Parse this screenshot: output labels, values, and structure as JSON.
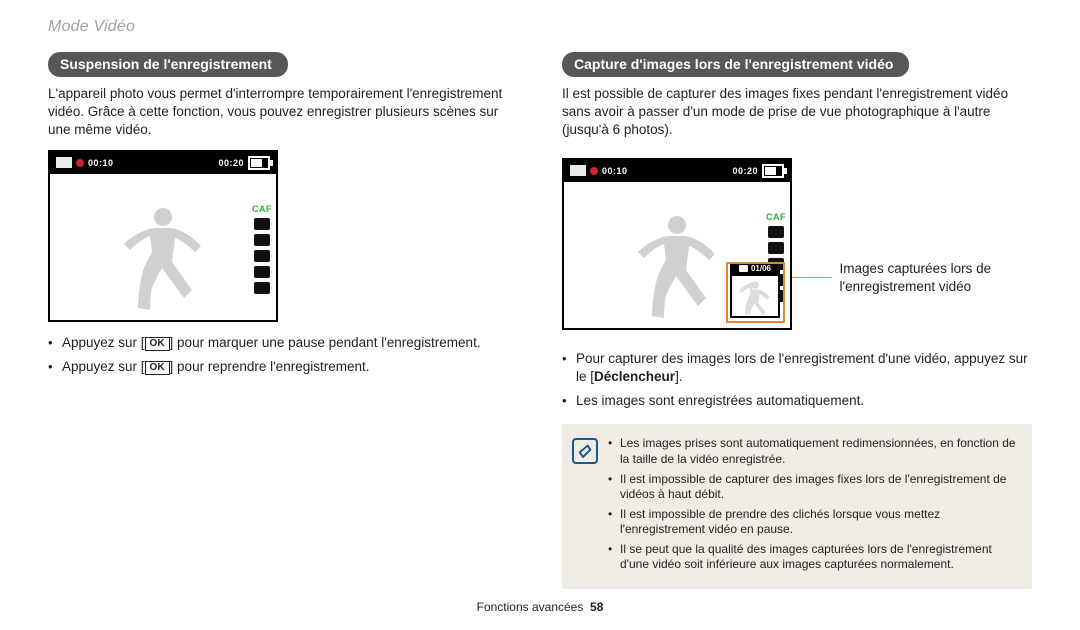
{
  "header": {
    "section": "Mode Vidéo"
  },
  "left": {
    "heading": "Suspension de l'enregistrement",
    "intro": "L'appareil photo vous permet d'interrompre temporairement l'enregistrement vidéo. Grâce à cette fonction, vous pouvez enregistrer plusieurs scènes sur une même vidéo.",
    "cam": {
      "elapsed": "00:10",
      "remaining": "00:20",
      "caf": "CAF"
    },
    "bul1a": "Appuyez sur [",
    "bul1b": "] pour marquer une pause pendant l'enregistrement.",
    "bul2a": "Appuyez sur [",
    "bul2b": "] pour reprendre l'enregistrement.",
    "ok": "OK"
  },
  "right": {
    "heading": "Capture d'images lors de l'enregistrement vidéo",
    "intro": "Il est possible de capturer des images fixes pendant l'enregistrement vidéo sans avoir à passer d'un mode de prise de vue photographique à l'autre (jusqu'à 6 photos).",
    "cam": {
      "elapsed": "00:10",
      "remaining": "00:20",
      "caf": "CAF",
      "capture_counter": "01/06"
    },
    "callout": "Images capturées lors de l'enregistrement vidéo",
    "bul1a": "Pour capturer des images lors de l'enregistrement d'une vidéo, appuyez sur le [",
    "bul1b": "Déclencheur",
    "bul1c": "].",
    "bul2": "Les images sont enregistrées automatiquement.",
    "note": {
      "n1": "Les images prises sont automatiquement redimensionnées, en fonction de la taille de la vidéo enregistrée.",
      "n2": "Il est impossible de capturer des images fixes lors de l'enregistrement de vidéos à haut débit.",
      "n3": "Il est impossible de prendre des clichés lorsque vous mettez l'enregistrement vidéo en pause.",
      "n4": "Il se peut que la qualité des images capturées lors de l'enregistrement d'une vidéo soit inférieure aux images capturées normalement."
    }
  },
  "footer": {
    "label": "Fonctions avancées",
    "page": "58"
  }
}
